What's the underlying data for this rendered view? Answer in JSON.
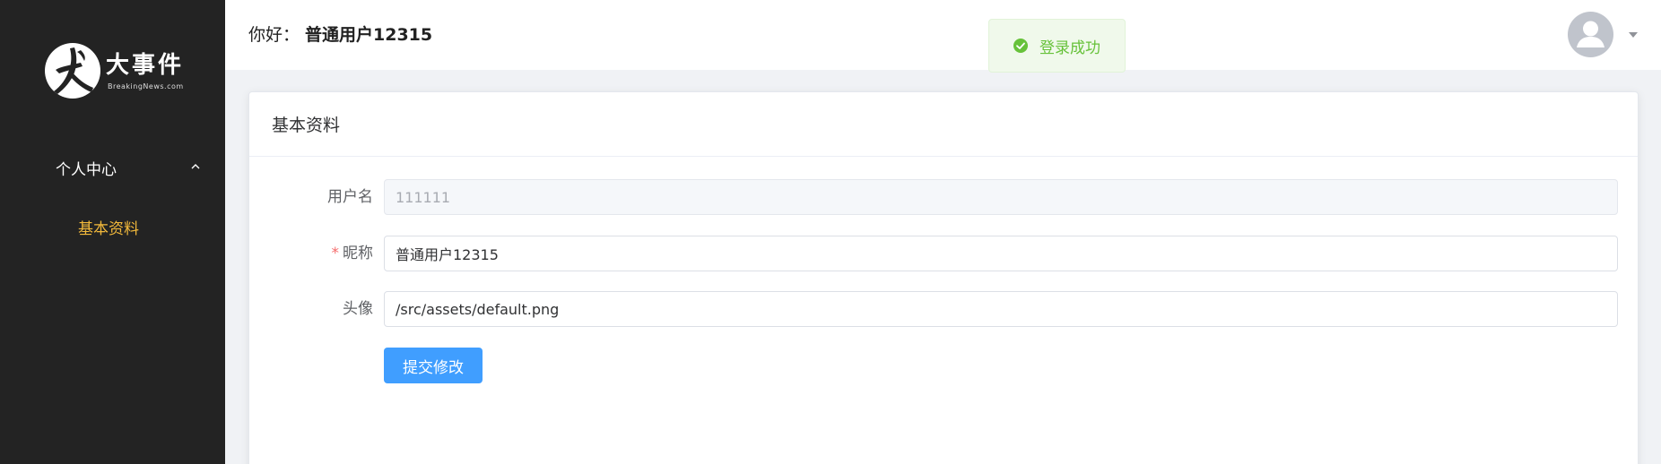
{
  "sidebar": {
    "logo": {
      "title": "大事件",
      "subtitle": "BreakingNews.com",
      "icon": "logo-mark"
    },
    "menu": {
      "group_label": "个人中心",
      "group_icon": "chevron-up-icon",
      "items": [
        {
          "label": "基本资料",
          "active": true
        }
      ]
    }
  },
  "header": {
    "greeting_prefix": "你好：",
    "user_name": "普通用户12315",
    "avatar_icon": "user-avatar-icon",
    "dropdown_icon": "caret-down-icon"
  },
  "toast": {
    "message": "登录成功",
    "icon": "check-circle-icon",
    "type": "success"
  },
  "card": {
    "title": "基本资料",
    "fields": {
      "username": {
        "label": "用户名",
        "value": "111111",
        "disabled": true
      },
      "nickname": {
        "label": "昵称",
        "required_mark": "*",
        "value": "普通用户12315"
      },
      "avatar": {
        "label": "头像",
        "value": "/src/assets/default.png"
      }
    },
    "submit_label": "提交修改"
  },
  "colors": {
    "sidebar_bg": "#232323",
    "active_menu": "#f2b93b",
    "primary": "#409eff",
    "success": "#67c23a",
    "required": "#f56c6c"
  }
}
